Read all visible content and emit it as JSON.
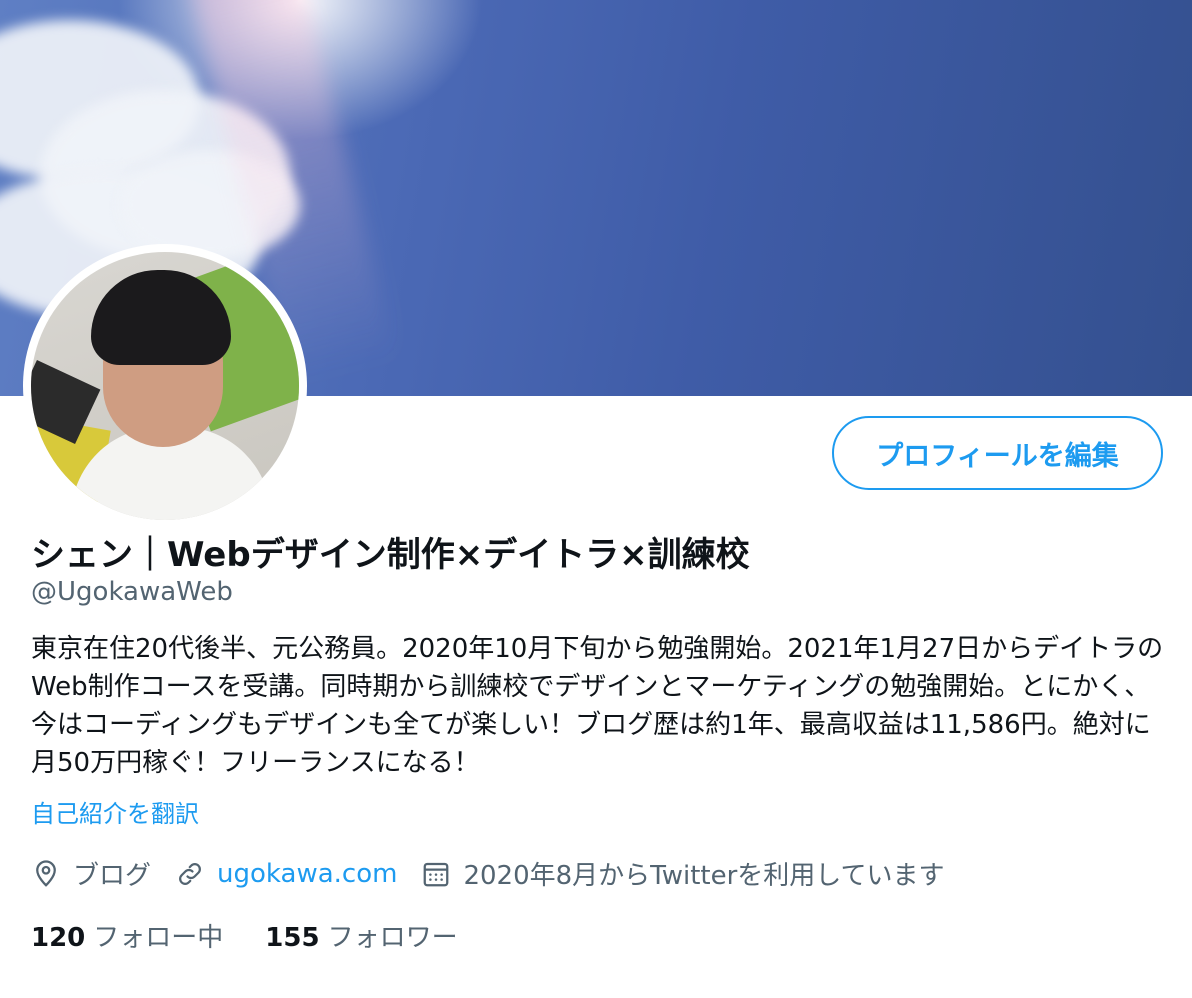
{
  "profile": {
    "edit_button": "プロフィールを編集",
    "display_name": "シェン｜Webデザイン制作×デイトラ×訓練校",
    "handle": "@UgokawaWeb",
    "bio": "東京在住20代後半、元公務員。2020年10月下旬から勉強開始。2021年1月27日からデイトラのWeb制作コースを受講。同時期から訓練校でデザインとマーケティングの勉強開始。とにかく、今はコーディングもデザインも全てが楽しい！ブログ歴は約1年、最高収益は11,586円。絶対に月50万円稼ぐ！フリーランスになる！",
    "translate_link": "自己紹介を翻訳",
    "location": "ブログ",
    "website": "ugokawa.com",
    "joined": "2020年8月からTwitterを利用しています",
    "following_count": "120",
    "following_label": "フォロー中",
    "followers_count": "155",
    "followers_label": "フォロワー"
  },
  "icons": {
    "location": "location-pin-icon",
    "website": "link-icon",
    "joined": "calendar-icon"
  },
  "colors": {
    "accent": "#1d9bf0",
    "secondary_text": "#536471",
    "primary_text": "#0f1419"
  }
}
